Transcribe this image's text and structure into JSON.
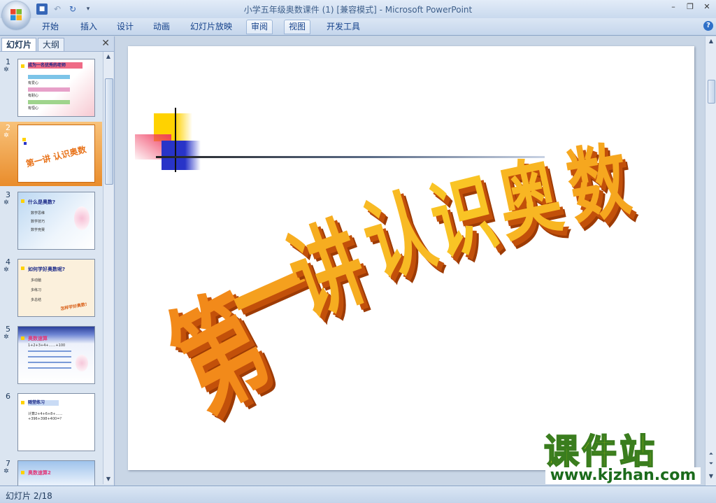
{
  "window": {
    "title": "小学五年级奥数课件 (1) [兼容模式] - Microsoft PowerPoint"
  },
  "ribbon": {
    "tabs": [
      "开始",
      "插入",
      "设计",
      "动画",
      "幻灯片放映",
      "审阅",
      "视图",
      "开发工具"
    ]
  },
  "left_pane": {
    "tabs": [
      "幻灯片",
      "大纲"
    ],
    "slides": [
      {
        "num": "1",
        "title": "成为一名优秀的老师",
        "items": [
          "有爱心",
          "有耐心",
          "有恒心"
        ]
      },
      {
        "num": "2",
        "title": "第一讲 认识奥数"
      },
      {
        "num": "3",
        "title": "什么是奥数?",
        "items": [
          "数学思维",
          "数学技巧",
          "数学竞赛"
        ]
      },
      {
        "num": "4",
        "title": "如何学好奥数呢?",
        "items": [
          "多动脑",
          "多练习",
          "多总结"
        ],
        "tag": "怎样学好奥数!"
      },
      {
        "num": "5",
        "title": "奥数速算",
        "items": [
          "1+2+3+4+……+100"
        ]
      },
      {
        "num": "6",
        "title": "随堂练习",
        "items": [
          "计算2+4+6+8+……+396+398+400=?"
        ]
      },
      {
        "num": "7",
        "title": "奥数速算2"
      }
    ]
  },
  "slide": {
    "heading": [
      "第",
      "一",
      "讲",
      "认",
      "识",
      "奥",
      "数"
    ]
  },
  "status": {
    "slide_indicator": "幻灯片 2/18"
  },
  "watermark": {
    "chinese": "课件站",
    "url": "www.kjzhan.com"
  },
  "colors": {
    "accent_orange": "#f28a1a",
    "accent_yellow": "#ffd200",
    "accent_blue": "#2834c8",
    "accent_pink": "#ef5873",
    "watermark_yellow": "#f4e400",
    "watermark_green": "#1b6b1b"
  }
}
